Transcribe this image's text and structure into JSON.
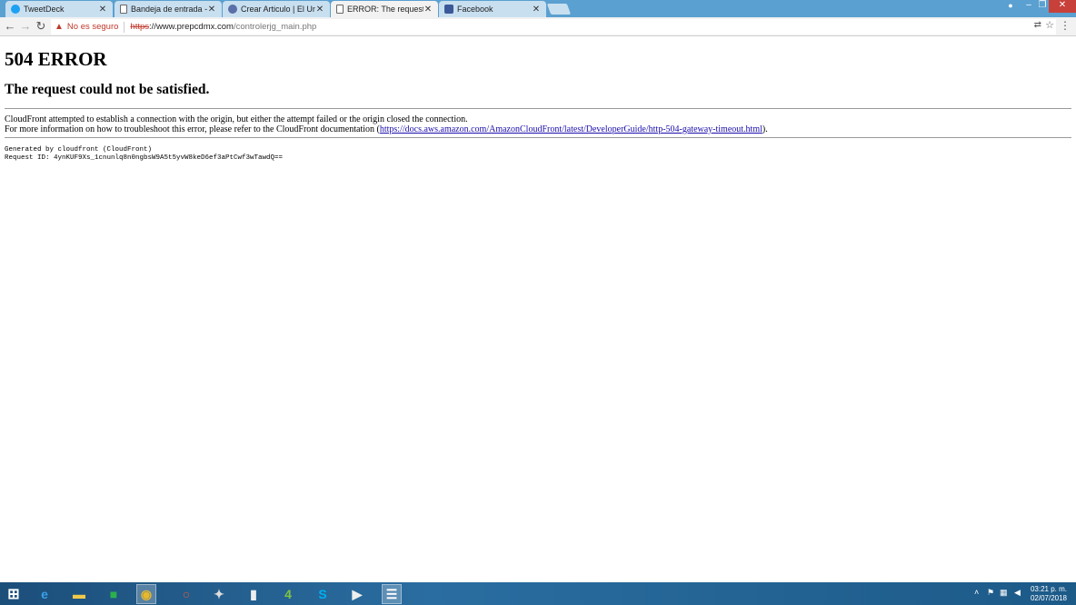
{
  "tabs": [
    {
      "title": "TweetDeck",
      "icon": "tweetdeck-icon"
    },
    {
      "title": "Bandeja de entrada - Ou",
      "icon": "page-icon"
    },
    {
      "title": "Crear Articulo | El Univers",
      "icon": "eluniversal-icon"
    },
    {
      "title": "ERROR: The request cou",
      "icon": "page-icon"
    },
    {
      "title": "Facebook",
      "icon": "facebook-icon"
    }
  ],
  "omnibox": {
    "security_label": "No es seguro",
    "url_scheme": "https",
    "url_host": "://www.prepcdmx.com",
    "url_path": "/controlerjg_main.php"
  },
  "page": {
    "heading": "504 ERROR",
    "subheading": "The request could not be satisfied.",
    "line1": "CloudFront attempted to establish a connection with the origin, but either the attempt failed or the origin closed the connection.",
    "line2_prefix": "For more information on how to troubleshoot this error, please refer to the CloudFront documentation (",
    "link": "https://docs.aws.amazon.com/AmazonCloudFront/latest/DeveloperGuide/http-504-gateway-timeout.html",
    "line2_suffix": ").",
    "generated_by": "Generated by cloudfront (CloudFront)",
    "request_id": "Request ID: 4ynKUF9Xs_1cnunlq8n0ngbsW9A5t5yvW8keD6ef3aPtCwf3wTawdQ=="
  },
  "taskbar": {
    "time": "03:21 p. m.",
    "date": "02/07/2018"
  }
}
